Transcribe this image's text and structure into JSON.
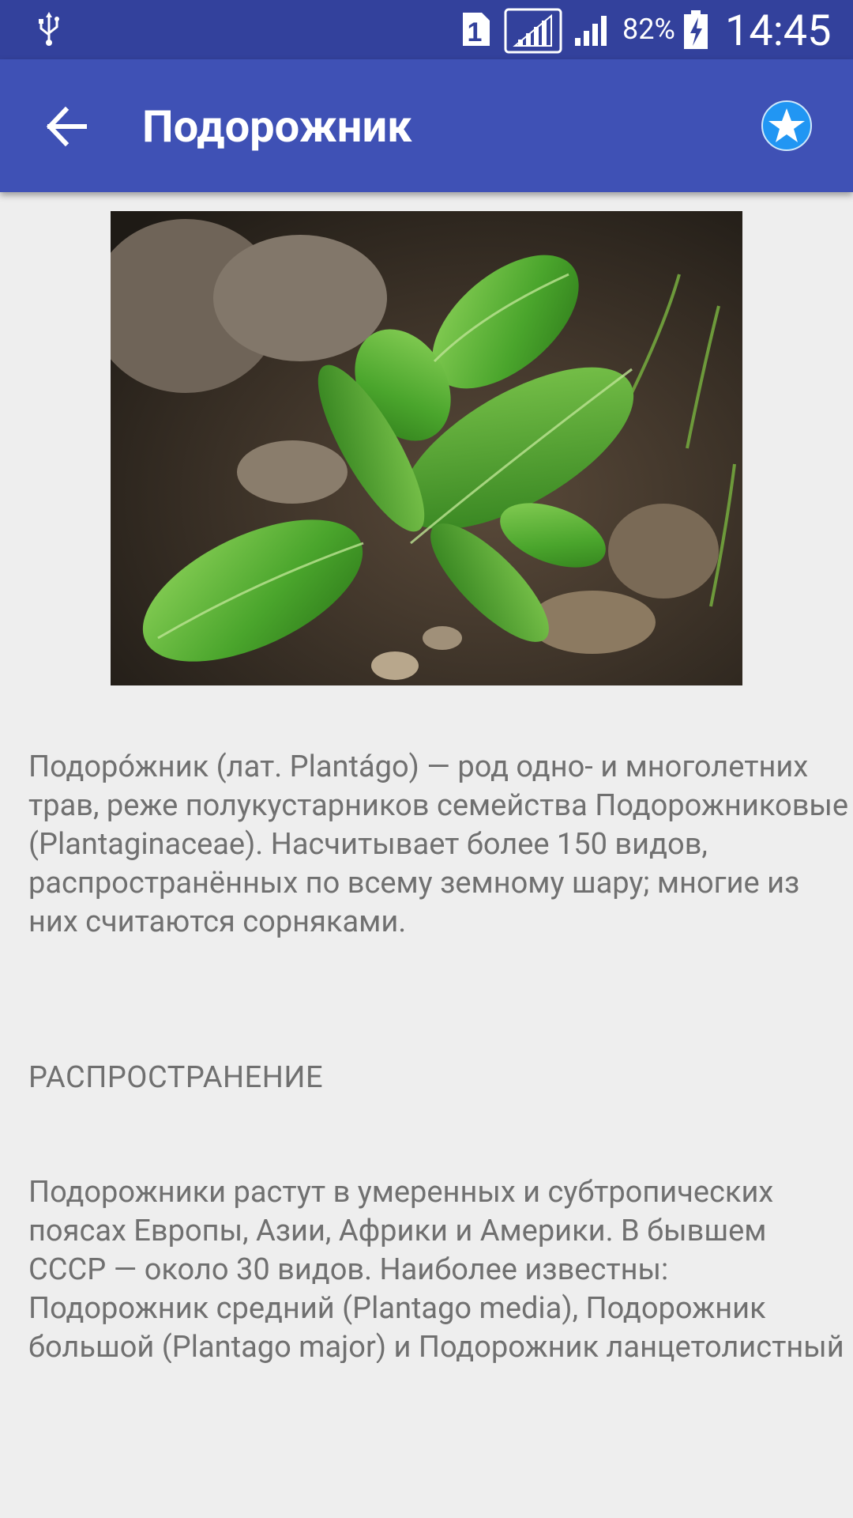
{
  "status_bar": {
    "battery_percent": "82%",
    "time": "14:45",
    "icons": [
      "usb-icon",
      "sim-1-icon",
      "signal-icon",
      "signal-icon",
      "battery-charging-icon"
    ]
  },
  "app_bar": {
    "title": "Подорожник",
    "back_icon": "arrow-back-icon",
    "favorite_icon": "star-icon"
  },
  "article": {
    "image": "plantain-plant-photo",
    "intro": "Подоро́жник (лат. Plantágo) — род одно- и многолетних трав, реже полукустарников семейства Подорожниковые (Plantaginaceae). Насчитывает более 150 видов, распространённых по всему земному шару; многие из них считаются сорняками.",
    "section_heading": "РАСПРОСТРАНЕНИЕ",
    "section_text": "Подорожники растут в умеренных и субтропических поясах Европы, Азии, Африки и Америки. В бывшем СССР — около 30 видов. Наиболее известны: Подорожник средний (Plantago media), Подорожник большой (Plantago major) и Подорожник ланцетолистный (Plantago lanceolata) —"
  },
  "colors": {
    "status_bar": "#33419c",
    "app_bar": "#3f51b5",
    "background": "#eeeeee",
    "favorite_blue": "#2196f3",
    "text": "#707070"
  }
}
